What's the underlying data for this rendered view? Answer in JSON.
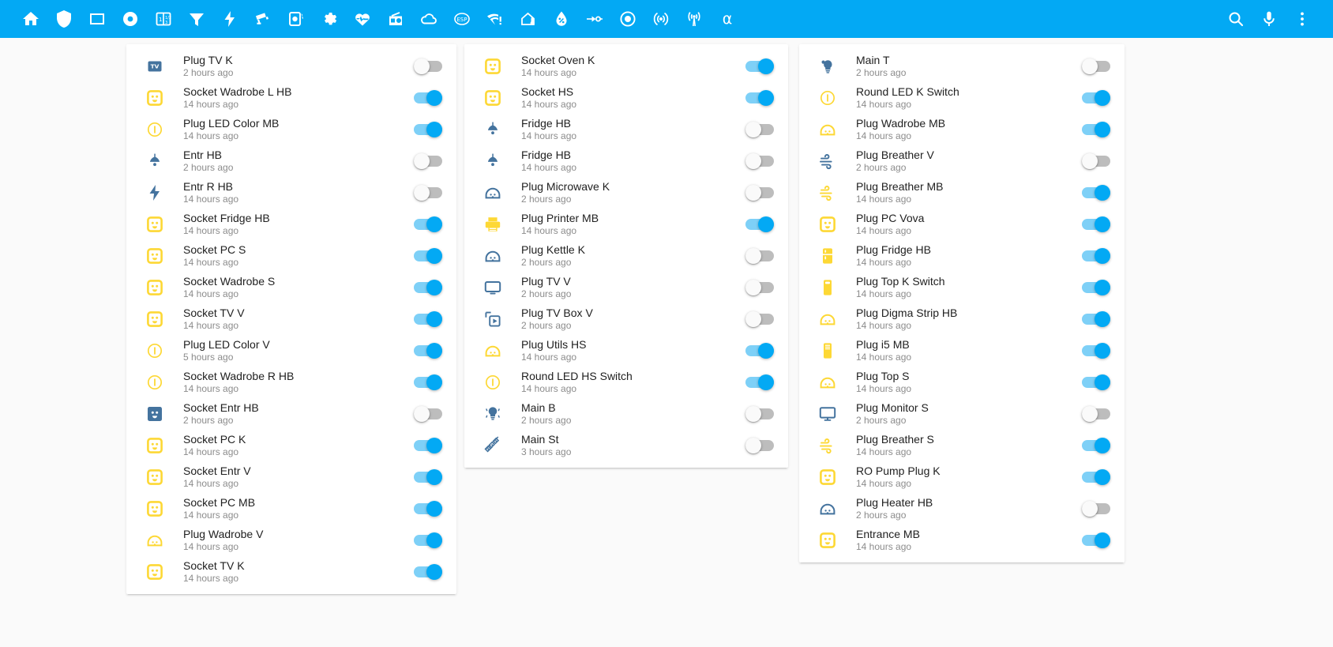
{
  "toolbar": {
    "left_icons": [
      {
        "name": "home-icon",
        "label": "Home"
      },
      {
        "name": "shield-icon",
        "label": "Security"
      },
      {
        "name": "square-outline-icon",
        "label": "Panel"
      },
      {
        "name": "record-circle-icon",
        "label": "Record"
      },
      {
        "name": "calendar-text-icon",
        "label": "Calendar"
      },
      {
        "name": "filter-icon",
        "label": "Filter"
      },
      {
        "name": "flash-icon",
        "label": "Energy"
      },
      {
        "name": "cctv-icon",
        "label": "Cameras"
      },
      {
        "name": "camera-iris-icon",
        "label": "Camera"
      },
      {
        "name": "cog-icon",
        "label": "Settings"
      },
      {
        "name": "heart-pulse-icon",
        "label": "Health"
      },
      {
        "name": "radio-icon",
        "label": "Radio"
      },
      {
        "name": "cloud-icon",
        "label": "Weather"
      },
      {
        "name": "esp-badge-icon",
        "label": "ESP"
      },
      {
        "name": "wifi-alert-icon",
        "label": "Wi-Fi"
      },
      {
        "name": "home-thermometer-icon",
        "label": "Climate"
      },
      {
        "name": "water-percent-icon",
        "label": "Humidity"
      },
      {
        "name": "pipe-valve-icon",
        "label": "Valves"
      },
      {
        "name": "circle-target-icon",
        "label": "Zones"
      },
      {
        "name": "access-point-icon",
        "label": "Access Point"
      },
      {
        "name": "broadcast-icon",
        "label": "Broadcast"
      },
      {
        "name": "alpha-icon",
        "label": "α"
      }
    ],
    "right_icons": [
      {
        "name": "search-icon",
        "label": "Search"
      },
      {
        "name": "microphone-icon",
        "label": "Voice assistant"
      },
      {
        "name": "overflow-menu-icon",
        "label": "More options"
      }
    ]
  },
  "colors": {
    "accent": "#03a9f4",
    "toggle_on_track": "#7ed0f7",
    "toggle_off_track": "#bdbdbd",
    "icon_yellow": "#fdd835",
    "icon_blue": "#44739e",
    "card_bg": "#ffffff",
    "page_bg": "#fafafa",
    "primary_text": "#212121",
    "secondary_text": "#8c8c8c"
  },
  "columns": [
    {
      "cards": [
        {
          "rows": [
            {
              "icon": "tv-badge-icon",
              "color": "blue",
              "name": "Plug TV K",
              "time": "2 hours ago",
              "state": "off"
            },
            {
              "icon": "power-socket-icon",
              "color": "yellow",
              "name": "Socket Wadrobe L HB",
              "time": "14 hours ago",
              "state": "on"
            },
            {
              "icon": "led-ring-icon",
              "color": "yellow",
              "name": "Plug LED Color MB",
              "time": "14 hours ago",
              "state": "on"
            },
            {
              "icon": "ceiling-light-icon",
              "color": "blue",
              "name": "Entr HB",
              "time": "2 hours ago",
              "state": "off"
            },
            {
              "icon": "flash-icon",
              "color": "blue",
              "name": "Entr R HB",
              "time": "14 hours ago",
              "state": "off"
            },
            {
              "icon": "power-socket-icon",
              "color": "yellow",
              "name": "Socket Fridge HB",
              "time": "14 hours ago",
              "state": "on"
            },
            {
              "icon": "power-socket-icon",
              "color": "yellow",
              "name": "Socket PC S",
              "time": "14 hours ago",
              "state": "on"
            },
            {
              "icon": "power-socket-icon",
              "color": "yellow",
              "name": "Socket Wadrobe S",
              "time": "14 hours ago",
              "state": "on"
            },
            {
              "icon": "power-socket-icon",
              "color": "yellow",
              "name": "Socket TV V",
              "time": "14 hours ago",
              "state": "on"
            },
            {
              "icon": "led-ring-icon",
              "color": "yellow",
              "name": "Plug LED Color V",
              "time": "5 hours ago",
              "state": "on"
            },
            {
              "icon": "led-ring-icon",
              "color": "yellow",
              "name": "Socket Wadrobe R HB",
              "time": "14 hours ago",
              "state": "on"
            },
            {
              "icon": "power-socket-filled-icon",
              "color": "blue-filled",
              "name": "Socket Entr HB",
              "time": "2 hours ago",
              "state": "off"
            },
            {
              "icon": "power-socket-icon",
              "color": "yellow",
              "name": "Socket PC K",
              "time": "14 hours ago",
              "state": "on"
            },
            {
              "icon": "power-socket-icon",
              "color": "yellow",
              "name": "Socket Entr V",
              "time": "14 hours ago",
              "state": "on"
            },
            {
              "icon": "power-socket-icon",
              "color": "yellow",
              "name": "Socket PC MB",
              "time": "14 hours ago",
              "state": "on"
            },
            {
              "icon": "power-plug-strip-icon",
              "color": "yellow",
              "name": "Plug Wadrobe V",
              "time": "14 hours ago",
              "state": "on"
            },
            {
              "icon": "power-socket-icon",
              "color": "yellow",
              "name": "Socket TV K",
              "time": "14 hours ago",
              "state": "on"
            }
          ]
        }
      ]
    },
    {
      "cards": [
        {
          "rows": [
            {
              "icon": "power-socket-icon",
              "color": "yellow",
              "name": "Socket Oven K",
              "time": "14 hours ago",
              "state": "on"
            },
            {
              "icon": "power-socket-icon",
              "color": "yellow",
              "name": "Socket HS",
              "time": "14 hours ago",
              "state": "on"
            },
            {
              "icon": "ceiling-light-icon",
              "color": "blue",
              "name": "Fridge HB",
              "time": "14 hours ago",
              "state": "off"
            },
            {
              "icon": "ceiling-light-icon",
              "color": "blue",
              "name": "Fridge HB",
              "time": "14 hours ago",
              "state": "off"
            },
            {
              "icon": "power-plug-strip-icon",
              "color": "blue",
              "name": "Plug Microwave K",
              "time": "2 hours ago",
              "state": "off"
            },
            {
              "icon": "printer-icon",
              "color": "yellow",
              "name": "Plug Printer MB",
              "time": "14 hours ago",
              "state": "on"
            },
            {
              "icon": "power-plug-strip-icon",
              "color": "blue",
              "name": "Plug Kettle K",
              "time": "2 hours ago",
              "state": "off"
            },
            {
              "icon": "television-icon",
              "color": "blue",
              "name": "Plug TV V",
              "time": "2 hours ago",
              "state": "off"
            },
            {
              "icon": "tv-box-icon",
              "color": "blue",
              "name": "Plug TV Box V",
              "time": "2 hours ago",
              "state": "off"
            },
            {
              "icon": "power-plug-strip-icon",
              "color": "yellow",
              "name": "Plug Utils HS",
              "time": "14 hours ago",
              "state": "on"
            },
            {
              "icon": "led-ring-icon",
              "color": "yellow",
              "name": "Round LED HS Switch",
              "time": "14 hours ago",
              "state": "on"
            },
            {
              "icon": "lightbulb-group-icon",
              "color": "blue",
              "name": "Main B",
              "time": "2 hours ago",
              "state": "off"
            },
            {
              "icon": "led-strip-icon",
              "color": "blue",
              "name": "Main St",
              "time": "3 hours ago",
              "state": "off"
            }
          ]
        }
      ]
    },
    {
      "cards": [
        {
          "rows": [
            {
              "icon": "lightbulb-icon",
              "color": "blue",
              "name": "Main T",
              "time": "2 hours ago",
              "state": "off"
            },
            {
              "icon": "led-ring-icon",
              "color": "yellow",
              "name": "Round LED K Switch",
              "time": "14 hours ago",
              "state": "on"
            },
            {
              "icon": "power-plug-strip-icon",
              "color": "yellow",
              "name": "Plug Wadrobe MB",
              "time": "14 hours ago",
              "state": "on"
            },
            {
              "icon": "weather-windy-icon",
              "color": "blue",
              "name": "Plug Breather V",
              "time": "2 hours ago",
              "state": "off"
            },
            {
              "icon": "weather-windy-icon",
              "color": "yellow",
              "name": "Plug Breather MB",
              "time": "14 hours ago",
              "state": "on"
            },
            {
              "icon": "power-socket-icon",
              "color": "yellow",
              "name": "Plug PC Vova",
              "time": "14 hours ago",
              "state": "on"
            },
            {
              "icon": "fridge-icon",
              "color": "yellow",
              "name": "Plug Fridge HB",
              "time": "14 hours ago",
              "state": "on"
            },
            {
              "icon": "desktop-tower-plain-icon",
              "color": "yellow",
              "name": "Plug Top K Switch",
              "time": "14 hours ago",
              "state": "on"
            },
            {
              "icon": "power-plug-strip-icon",
              "color": "yellow",
              "name": "Plug Digma Strip HB",
              "time": "14 hours ago",
              "state": "on"
            },
            {
              "icon": "desktop-tower-icon",
              "color": "yellow",
              "name": "Plug i5 MB",
              "time": "14 hours ago",
              "state": "on"
            },
            {
              "icon": "power-plug-strip-icon",
              "color": "yellow",
              "name": "Plug Top S",
              "time": "14 hours ago",
              "state": "on"
            },
            {
              "icon": "monitor-icon",
              "color": "blue",
              "name": "Plug Monitor S",
              "time": "2 hours ago",
              "state": "off"
            },
            {
              "icon": "weather-windy-icon",
              "color": "yellow",
              "name": "Plug Breather S",
              "time": "14 hours ago",
              "state": "on"
            },
            {
              "icon": "power-socket-icon",
              "color": "yellow",
              "name": "RO Pump Plug K",
              "time": "14 hours ago",
              "state": "on"
            },
            {
              "icon": "power-plug-strip-icon",
              "color": "blue",
              "name": "Plug Heater HB",
              "time": "2 hours ago",
              "state": "off"
            },
            {
              "icon": "power-socket-icon",
              "color": "yellow",
              "name": "Entrance MB",
              "time": "14 hours ago",
              "state": "on"
            }
          ]
        }
      ]
    }
  ]
}
